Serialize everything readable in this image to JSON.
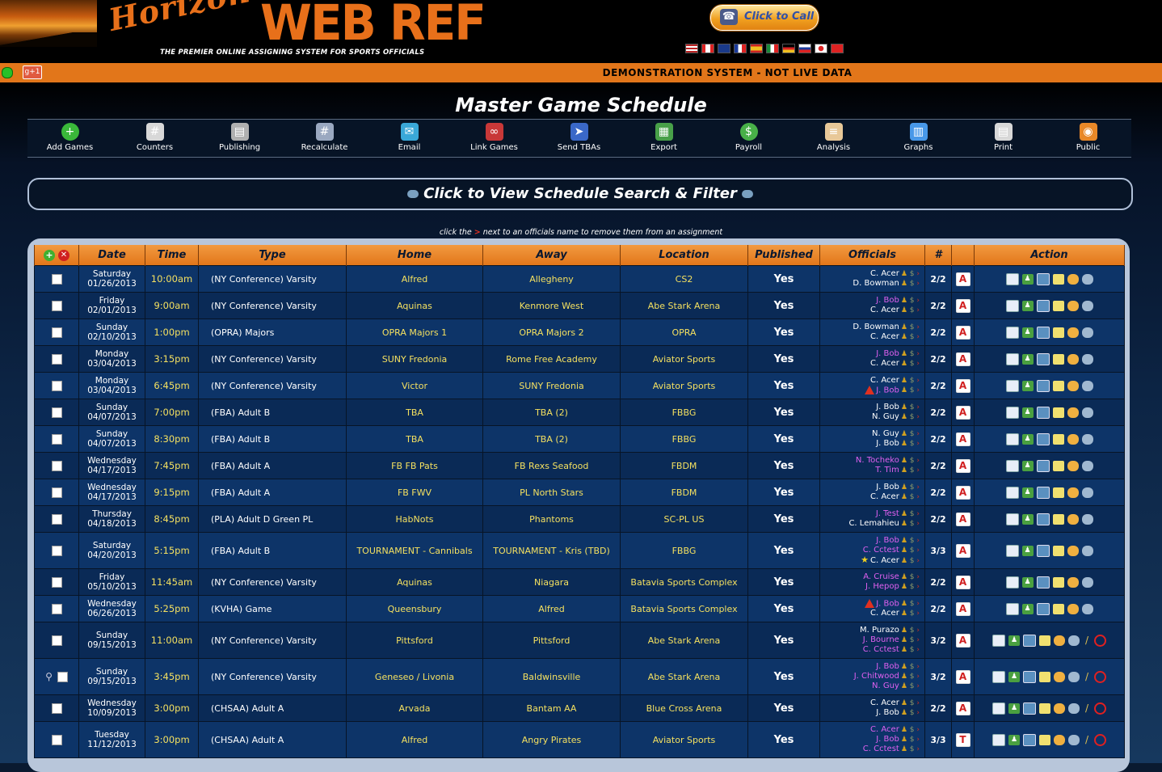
{
  "header": {
    "logo_horizon": "Horizon",
    "logo_webref": "WEB REF",
    "tagline": "THE PREMIER ONLINE ASSIGNING SYSTEM FOR SPORTS OFFICIALS",
    "call_button": "Click to Call",
    "flags": [
      "us-flag",
      "ca-flag",
      "uk-flag",
      "fr-flag",
      "es-flag",
      "it-flag",
      "de-flag",
      "ru-flag",
      "jp-flag",
      "cn-flag"
    ]
  },
  "topbar": {
    "gplus_label": "g+1",
    "demo_text": "DEMONSTRATION SYSTEM - NOT LIVE DATA"
  },
  "page_title": "Master Game Schedule",
  "toolbar": [
    {
      "label": "Add Games",
      "icon": "plus-icon",
      "color": "#3ab83a"
    },
    {
      "label": "Counters",
      "icon": "calculator-icon",
      "color": "#d8d8d8"
    },
    {
      "label": "Publishing",
      "icon": "printer-icon",
      "color": "#b0b0b0"
    },
    {
      "label": "Recalculate",
      "icon": "calculator-icon",
      "color": "#9aa8c0"
    },
    {
      "label": "Email",
      "icon": "email-icon",
      "color": "#3aa8d8"
    },
    {
      "label": "Link Games",
      "icon": "link-icon",
      "color": "#c83838"
    },
    {
      "label": "Send TBAs",
      "icon": "send-icon",
      "color": "#3a68c8"
    },
    {
      "label": "Export",
      "icon": "export-icon",
      "color": "#48a048"
    },
    {
      "label": "Payroll",
      "icon": "dollar-icon",
      "color": "#48b048"
    },
    {
      "label": "Analysis",
      "icon": "document-icon",
      "color": "#e8c898"
    },
    {
      "label": "Graphs",
      "icon": "graph-icon",
      "color": "#4898e8"
    },
    {
      "label": "Print",
      "icon": "print-icon",
      "color": "#d8d8d8"
    },
    {
      "label": "Public",
      "icon": "public-icon",
      "color": "#e88828"
    }
  ],
  "filter_bar": "Click to View Schedule Search & Filter",
  "hint": {
    "before": "click the",
    "mark": ">",
    "after": "next to an officials name to remove them from an assignment"
  },
  "columns": [
    "Date",
    "Time",
    "Type",
    "Home",
    "Away",
    "Location",
    "Published",
    "Officials",
    "#",
    "",
    "Action"
  ],
  "games": [
    {
      "day": "Saturday",
      "date": "01/26/2013",
      "time": "10:00am",
      "type": "(NY Conference) Varsity",
      "home": "Alfred",
      "away": "Allegheny",
      "location": "CS2",
      "published": "Yes",
      "officials": [
        {
          "name": "C. Acer",
          "pink": false
        },
        {
          "name": "D. Bowman",
          "pink": false
        }
      ],
      "count": "2/2",
      "badge": "A",
      "extra": false,
      "link": false
    },
    {
      "day": "Friday",
      "date": "02/01/2013",
      "time": "9:00am",
      "type": "(NY Conference) Varsity",
      "home": "Aquinas",
      "away": "Kenmore West",
      "location": "Abe Stark Arena",
      "published": "Yes",
      "officials": [
        {
          "name": "J. Bob",
          "pink": true
        },
        {
          "name": "C. Acer",
          "pink": false
        }
      ],
      "count": "2/2",
      "badge": "A",
      "extra": false,
      "link": false
    },
    {
      "day": "Sunday",
      "date": "02/10/2013",
      "time": "1:00pm",
      "type": "(OPRA) Majors",
      "home": "OPRA Majors 1",
      "away": "OPRA Majors 2",
      "location": "OPRA",
      "published": "Yes",
      "officials": [
        {
          "name": "D. Bowman",
          "pink": false
        },
        {
          "name": "C. Acer",
          "pink": false
        }
      ],
      "count": "2/2",
      "badge": "A",
      "extra": false,
      "link": false
    },
    {
      "day": "Monday",
      "date": "03/04/2013",
      "time": "3:15pm",
      "type": "(NY Conference) Varsity",
      "home": "SUNY Fredonia",
      "away": "Rome Free Academy",
      "location": "Aviator Sports",
      "published": "Yes",
      "officials": [
        {
          "name": "J. Bob",
          "pink": true
        },
        {
          "name": "C. Acer",
          "pink": false
        }
      ],
      "count": "2/2",
      "badge": "A",
      "extra": false,
      "link": false
    },
    {
      "day": "Monday",
      "date": "03/04/2013",
      "time": "6:45pm",
      "type": "(NY Conference) Varsity",
      "home": "Victor",
      "away": "SUNY Fredonia",
      "location": "Aviator Sports",
      "published": "Yes",
      "officials": [
        {
          "name": "C. Acer",
          "pink": false
        },
        {
          "name": "J. Bob",
          "pink": true,
          "warn": true
        }
      ],
      "count": "2/2",
      "badge": "A",
      "extra": false,
      "link": false
    },
    {
      "day": "Sunday",
      "date": "04/07/2013",
      "time": "7:00pm",
      "type": "(FBA) Adult B",
      "home": "TBA",
      "away": "TBA (2)",
      "location": "FBBG",
      "published": "Yes",
      "officials": [
        {
          "name": "J. Bob",
          "pink": false
        },
        {
          "name": "N. Guy",
          "pink": false
        }
      ],
      "count": "2/2",
      "badge": "A",
      "extra": false,
      "link": false
    },
    {
      "day": "Sunday",
      "date": "04/07/2013",
      "time": "8:30pm",
      "type": "(FBA) Adult B",
      "home": "TBA",
      "away": "TBA (2)",
      "location": "FBBG",
      "published": "Yes",
      "officials": [
        {
          "name": "N. Guy",
          "pink": false
        },
        {
          "name": "J. Bob",
          "pink": false
        }
      ],
      "count": "2/2",
      "badge": "A",
      "extra": false,
      "link": false
    },
    {
      "day": "Wednesday",
      "date": "04/17/2013",
      "time": "7:45pm",
      "type": "(FBA) Adult A",
      "home": "FB FB Pats",
      "away": "FB Rexs Seafood",
      "location": "FBDM",
      "published": "Yes",
      "officials": [
        {
          "name": "N. Tocheko",
          "pink": true
        },
        {
          "name": "T. Tim",
          "pink": true
        }
      ],
      "count": "2/2",
      "badge": "A",
      "extra": false,
      "link": false
    },
    {
      "day": "Wednesday",
      "date": "04/17/2013",
      "time": "9:15pm",
      "type": "(FBA) Adult A",
      "home": "FB FWV",
      "away": "PL North Stars",
      "location": "FBDM",
      "published": "Yes",
      "officials": [
        {
          "name": "J. Bob",
          "pink": false
        },
        {
          "name": "C. Acer",
          "pink": false
        }
      ],
      "count": "2/2",
      "badge": "A",
      "extra": false,
      "link": false
    },
    {
      "day": "Thursday",
      "date": "04/18/2013",
      "time": "8:45pm",
      "type": "(PLA) Adult D Green PL",
      "home": "HabNots",
      "away": "Phantoms",
      "location": "SC-PL US",
      "published": "Yes",
      "officials": [
        {
          "name": "J. Test",
          "pink": true
        },
        {
          "name": "C. Lemahieu",
          "pink": false
        }
      ],
      "count": "2/2",
      "badge": "A",
      "extra": false,
      "link": false
    },
    {
      "day": "Saturday",
      "date": "04/20/2013",
      "time": "5:15pm",
      "type": "(FBA) Adult B",
      "home": "TOURNAMENT - Cannibals",
      "away": "TOURNAMENT - Kris (TBD)",
      "location": "FBBG",
      "published": "Yes",
      "officials": [
        {
          "name": "J. Bob",
          "pink": true
        },
        {
          "name": "C. Cctest",
          "pink": true
        },
        {
          "name": "C. Acer",
          "pink": false,
          "star": true
        }
      ],
      "count": "3/3",
      "badge": "A",
      "extra": false,
      "link": false
    },
    {
      "day": "Friday",
      "date": "05/10/2013",
      "time": "11:45am",
      "type": "(NY Conference) Varsity",
      "home": "Aquinas",
      "away": "Niagara",
      "location": "Batavia Sports Complex",
      "published": "Yes",
      "officials": [
        {
          "name": "A. Cruise",
          "pink": true
        },
        {
          "name": "J. Hepop",
          "pink": true
        }
      ],
      "count": "2/2",
      "badge": "A",
      "extra": false,
      "link": false
    },
    {
      "day": "Wednesday",
      "date": "06/26/2013",
      "time": "5:25pm",
      "type": "(KVHA) Game",
      "home": "Queensbury",
      "away": "Alfred",
      "location": "Batavia Sports Complex",
      "published": "Yes",
      "officials": [
        {
          "name": "J. Bob",
          "pink": true,
          "warn": true
        },
        {
          "name": "C. Acer",
          "pink": false
        }
      ],
      "count": "2/2",
      "badge": "A",
      "extra": false,
      "link": false
    },
    {
      "day": "Sunday",
      "date": "09/15/2013",
      "time": "11:00am",
      "type": "(NY Conference) Varsity",
      "home": "Pittsford",
      "away": "Pittsford",
      "location": "Abe Stark Arena",
      "published": "Yes",
      "officials": [
        {
          "name": "M. Purazo",
          "pink": false
        },
        {
          "name": "J. Bourne",
          "pink": true
        },
        {
          "name": "C. Cctest",
          "pink": true
        }
      ],
      "count": "3/2",
      "badge": "A",
      "extra": true,
      "link": false
    },
    {
      "day": "Sunday",
      "date": "09/15/2013",
      "time": "3:45pm",
      "type": "(NY Conference) Varsity",
      "home": "Geneseo / Livonia",
      "away": "Baldwinsville",
      "location": "Abe Stark Arena",
      "published": "Yes",
      "officials": [
        {
          "name": "J. Bob",
          "pink": true
        },
        {
          "name": "J. Chitwood",
          "pink": true
        },
        {
          "name": "N. Guy",
          "pink": true
        }
      ],
      "count": "3/2",
      "badge": "A",
      "extra": true,
      "link": true
    },
    {
      "day": "Wednesday",
      "date": "10/09/2013",
      "time": "3:00pm",
      "type": "(CHSAA) Adult A",
      "home": "Arvada",
      "away": "Bantam AA",
      "location": "Blue Cross Arena",
      "published": "Yes",
      "officials": [
        {
          "name": "C. Acer",
          "pink": false
        },
        {
          "name": "J. Bob",
          "pink": false
        }
      ],
      "count": "2/2",
      "badge": "A",
      "extra": true,
      "link": false
    },
    {
      "day": "Tuesday",
      "date": "11/12/2013",
      "time": "3:00pm",
      "type": "(CHSAA) Adult A",
      "home": "Alfred",
      "away": "Angry Pirates",
      "location": "Aviator Sports",
      "published": "Yes",
      "officials": [
        {
          "name": "C. Acer",
          "pink": true
        },
        {
          "name": "J. Bob",
          "pink": true
        },
        {
          "name": "C. Cctest",
          "pink": true
        }
      ],
      "count": "3/3",
      "badge": "T",
      "extra": true,
      "link": false
    }
  ]
}
